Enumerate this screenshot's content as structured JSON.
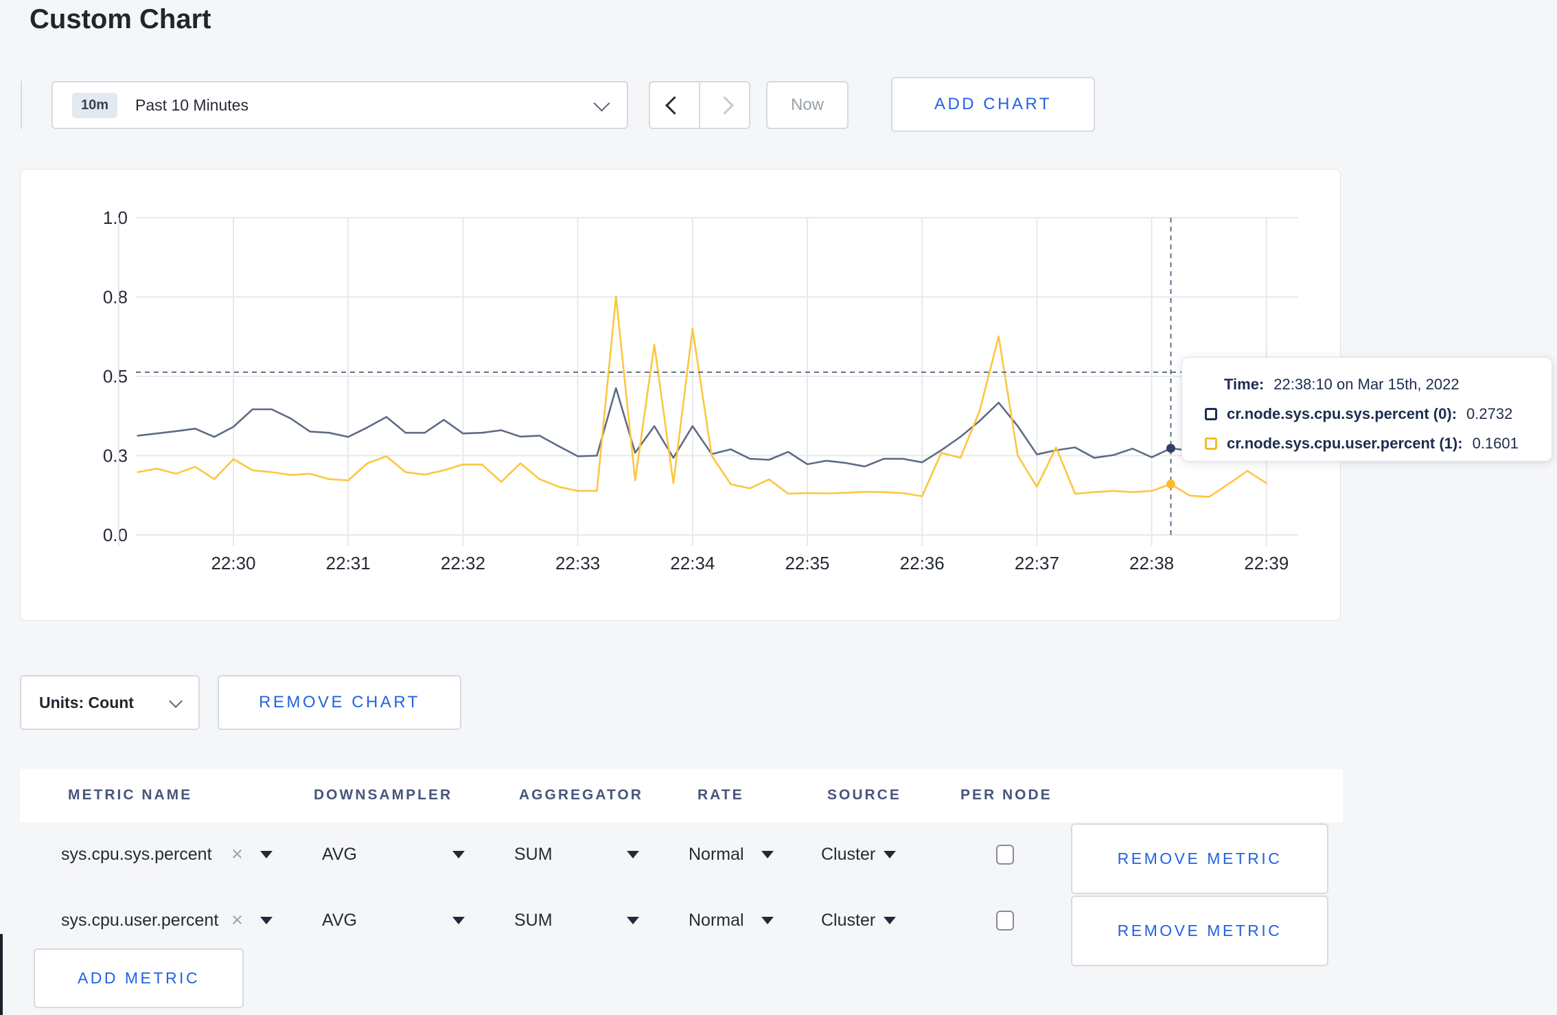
{
  "page": {
    "title": "Custom Chart"
  },
  "toolbar": {
    "time_range": {
      "badge": "10m",
      "label": "Past 10 Minutes"
    },
    "now_label": "Now",
    "add_chart_label": "ADD CHART"
  },
  "chart_data": {
    "type": "line",
    "title": "",
    "xlabel": "",
    "ylabel": "",
    "ylim": [
      0,
      1
    ],
    "grid": true,
    "legend_position": "tooltip",
    "y_tick_labels": [
      "0.0",
      "0.3",
      "0.5",
      "0.8",
      "1.0"
    ],
    "y_tick_values": [
      0,
      0.25,
      0.5,
      0.75,
      1.0
    ],
    "x_ticks": [
      "22:30",
      "22:31",
      "22:32",
      "22:33",
      "22:34",
      "22:35",
      "22:36",
      "22:37",
      "22:38",
      "22:39"
    ],
    "start_time": "22:29:10",
    "interval_seconds": 10,
    "series": [
      {
        "name": "cr.node.sys.cpu.sys.percent (0)",
        "color": "#5d6b85",
        "values": [
          0.313,
          0.32,
          0.327,
          0.335,
          0.309,
          0.341,
          0.396,
          0.396,
          0.367,
          0.326,
          0.322,
          0.309,
          0.339,
          0.372,
          0.322,
          0.322,
          0.363,
          0.32,
          0.322,
          0.33,
          0.31,
          0.313,
          0.28,
          0.248,
          0.25,
          0.463,
          0.259,
          0.343,
          0.243,
          0.343,
          0.255,
          0.27,
          0.24,
          0.237,
          0.262,
          0.223,
          0.234,
          0.227,
          0.216,
          0.24,
          0.24,
          0.229,
          0.267,
          0.309,
          0.359,
          0.417,
          0.343,
          0.254,
          0.267,
          0.276,
          0.243,
          0.252,
          0.272,
          0.245,
          0.2732,
          0.266,
          0.27,
          0.265,
          0.272,
          0.268
        ]
      },
      {
        "name": "cr.node.sys.cpu.user.percent (1)",
        "color": "#fcc63e",
        "values": [
          0.198,
          0.209,
          0.193,
          0.215,
          0.176,
          0.239,
          0.204,
          0.198,
          0.189,
          0.193,
          0.176,
          0.172,
          0.226,
          0.248,
          0.198,
          0.19,
          0.204,
          0.222,
          0.222,
          0.167,
          0.226,
          0.176,
          0.152,
          0.139,
          0.139,
          0.752,
          0.172,
          0.6,
          0.163,
          0.65,
          0.25,
          0.16,
          0.147,
          0.175,
          0.13,
          0.132,
          0.131,
          0.133,
          0.136,
          0.135,
          0.132,
          0.122,
          0.259,
          0.243,
          0.39,
          0.626,
          0.25,
          0.152,
          0.276,
          0.13,
          0.135,
          0.139,
          0.135,
          0.139,
          0.1601,
          0.124,
          0.12,
          0.16,
          0.202,
          0.163
        ]
      }
    ],
    "crosshair": {
      "time": "22:38:10",
      "hline_value": 0.513,
      "points": [
        {
          "value": 0.2732,
          "color": "#2f4061"
        },
        {
          "value": 0.1601,
          "color": "#fcba2a"
        }
      ]
    }
  },
  "tooltip": {
    "time_label": "Time:",
    "time_value": "22:38:10 on Mar 15th, 2022",
    "rows": [
      {
        "label": "cr.node.sys.cpu.sys.percent (0):",
        "value": "0.2732"
      },
      {
        "label": "cr.node.sys.cpu.user.percent (1):",
        "value": "0.1601"
      }
    ]
  },
  "chart_controls": {
    "units_label": "Units: Count",
    "remove_chart_label": "REMOVE CHART"
  },
  "metrics": {
    "columns": [
      "METRIC NAME",
      "DOWNSAMPLER",
      "AGGREGATOR",
      "RATE",
      "SOURCE",
      "PER NODE"
    ],
    "clear_icon": "×",
    "rows": [
      {
        "metric": "sys.cpu.sys.percent",
        "downsampler": "AVG",
        "aggregator": "SUM",
        "rate": "Normal",
        "source": "Cluster",
        "per_node": false,
        "remove_label": "REMOVE METRIC"
      },
      {
        "metric": "sys.cpu.user.percent",
        "downsampler": "AVG",
        "aggregator": "SUM",
        "rate": "Normal",
        "source": "Cluster",
        "per_node": false,
        "remove_label": "REMOVE METRIC"
      }
    ],
    "add_metric_label": "ADD METRIC"
  }
}
